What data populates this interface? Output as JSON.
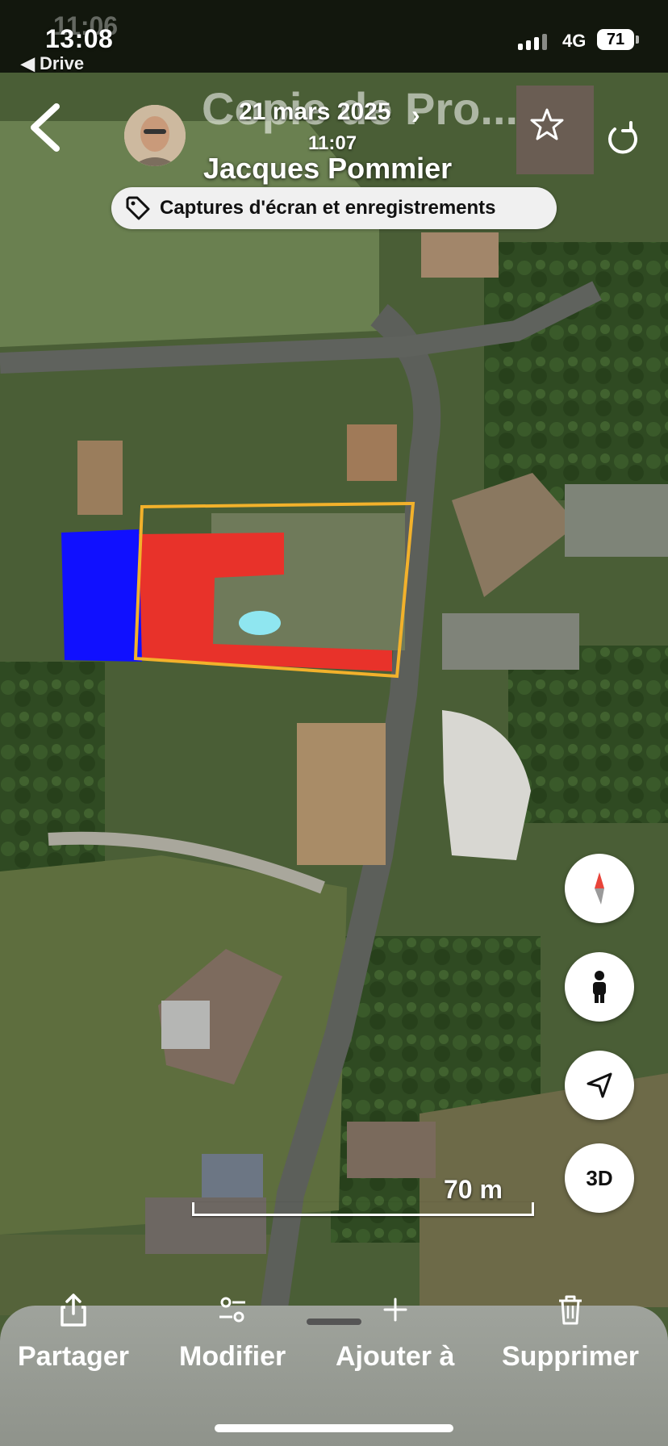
{
  "status_bar": {
    "time": "13:08",
    "ghost_time": "11:06",
    "back_app": "◀ Drive",
    "network": "4G",
    "battery": "71"
  },
  "header": {
    "ghost_title": "Copie de Pro...",
    "date": "21 mars 2025",
    "time": "11:07",
    "owner_name": "Jacques Pommier",
    "tag_label": "Captures d'écran et enregistrements"
  },
  "map": {
    "scale_label": "70 m",
    "parcel_outline_color": "#f2b12b",
    "red_zone_color": "#e8322a",
    "blue_zone_color": "#1010ff"
  },
  "controls": {
    "compass_icon": "compass-icon",
    "street_view_icon": "person-icon",
    "locate_icon": "navigation-arrow-icon",
    "three_d_label": "3D"
  },
  "toolbar": {
    "share_label": "Partager",
    "edit_label": "Modifier",
    "add_label": "Ajouter à",
    "delete_label": "Supprimer"
  }
}
